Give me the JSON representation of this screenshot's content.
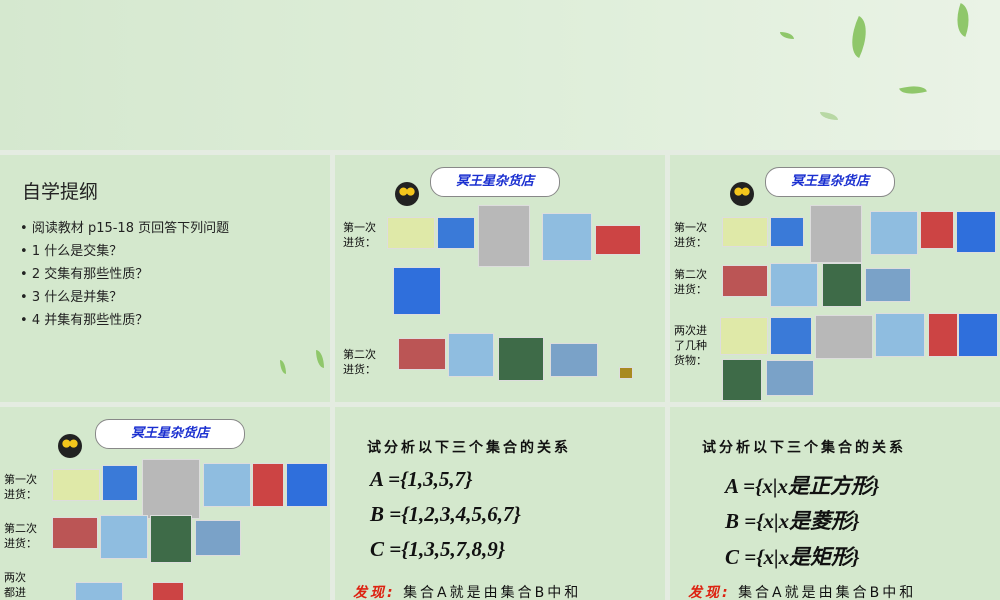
{
  "slide1": {
    "title": "自学提纲",
    "bullets": [
      "阅读教材 p15-18 页回答下列问题",
      "1 什么是交集？",
      "2 交集有那些性质？",
      "3 什么是并集？",
      "4 并集有那些性质？"
    ]
  },
  "store": {
    "logo": "冥王星杂货店"
  },
  "slide2": {
    "label1": "第一次进货：",
    "label2": "第二次进货："
  },
  "slide3": {
    "label1": "第一次进货：",
    "label2": "第二次进货：",
    "label3": "两次进了几种货物："
  },
  "slide4": {
    "label1": "第一次进货：",
    "label2": "第二次进货：",
    "label3": "两次都进"
  },
  "slide5": {
    "heading": "试分析以下三个集合的关系",
    "a": "A ={1,3,5,7}",
    "b": "B ={1,2,3,4,5,6,7}",
    "c": "C ={1,3,5,7,8,9}",
    "find_label": "发现:",
    "find_text": "集合A就是由集合B中和"
  },
  "slide6": {
    "heading": "试分析以下三个集合的关系",
    "a": "A ={x|x是正方形}",
    "b": "B ={x|x是菱形}",
    "c": "C ={x|x是矩形}",
    "find_label": "发现:",
    "find_text": "集合A就是由集合B中和"
  }
}
